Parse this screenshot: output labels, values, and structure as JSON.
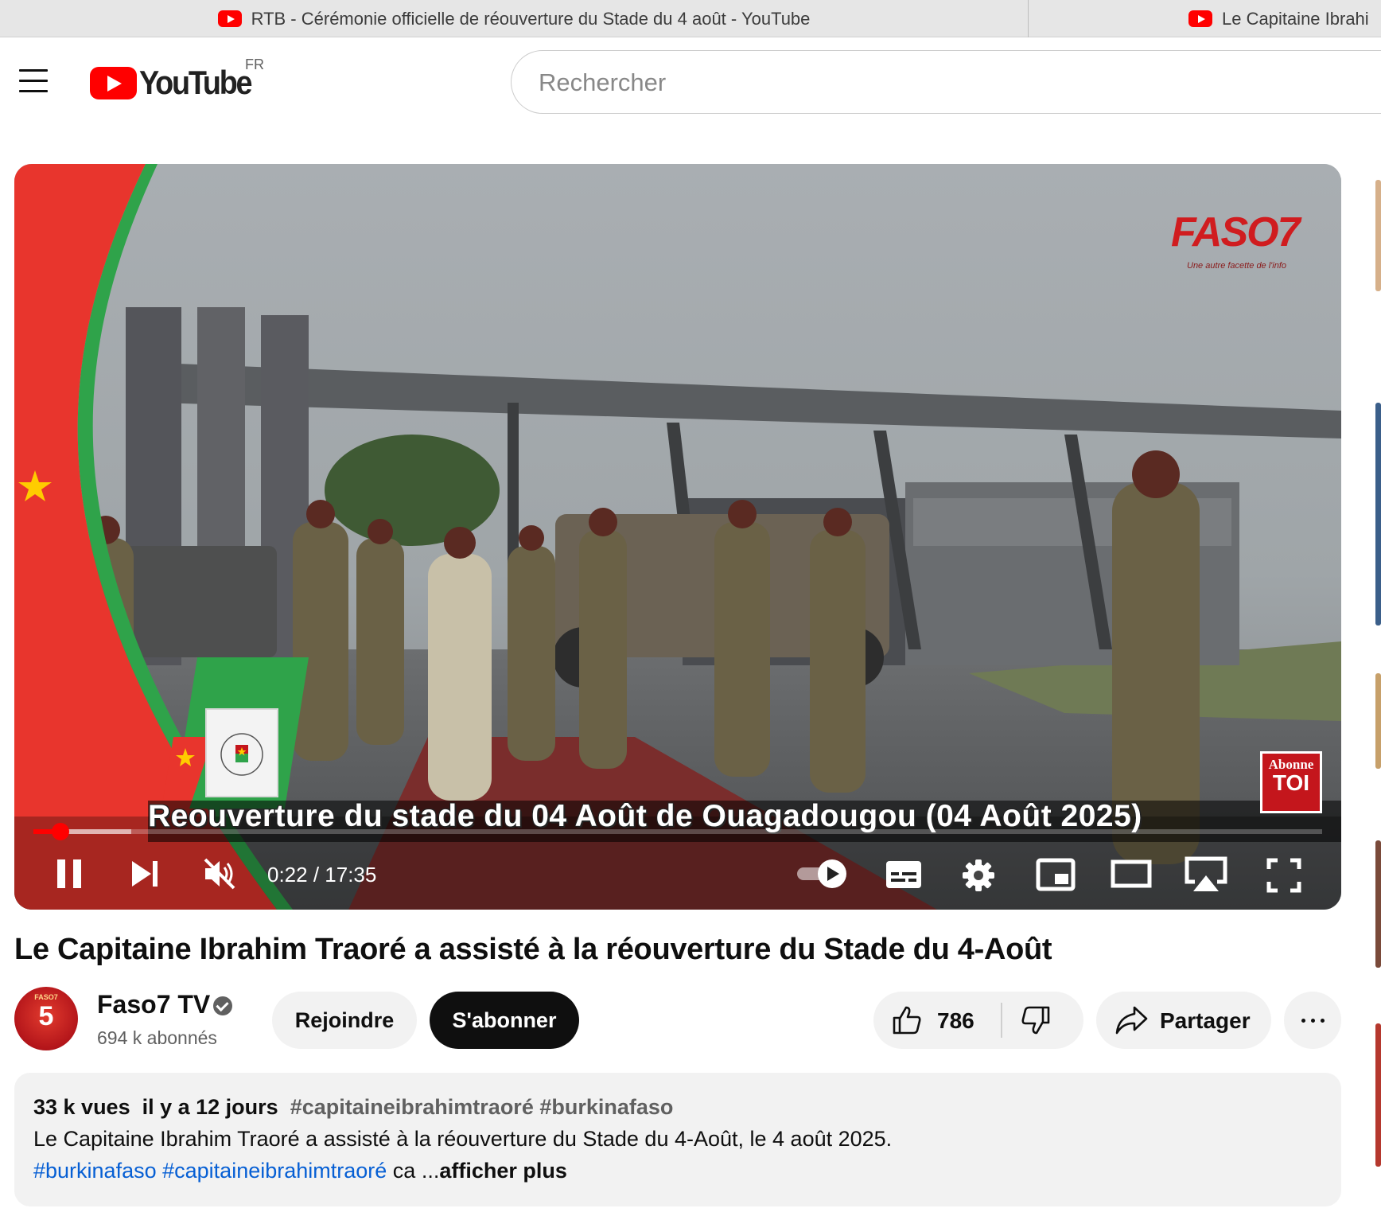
{
  "browser": {
    "tabs": [
      {
        "title": "RTB - Cérémonie officielle de réouverture du Stade du 4 août - YouTube",
        "active": true
      },
      {
        "title": "Le Capitaine Ibrahi",
        "active": false
      }
    ]
  },
  "masthead": {
    "logo_text": "YouTube",
    "region": "FR",
    "search_placeholder": "Rechercher"
  },
  "player": {
    "watermark": "FASO7",
    "watermark_tagline": "Une autre facette de l'info",
    "subscribe_badge_top": "Abonne",
    "subscribe_badge_bottom": "TOI",
    "lower_third": "Reouverture du stade du 04 Août de Ouagadougou (04 Août 2025)",
    "time_current": "0:22",
    "time_total": "17:35",
    "timecode": "0:22 / 17:35",
    "progress_played_pct": 2.1,
    "progress_loaded_pct": 7.6,
    "controls": [
      "pause-icon",
      "next-icon",
      "muted-icon",
      "autoplay-toggle",
      "subtitles-icon",
      "settings-icon",
      "miniplayer-icon",
      "theater-icon",
      "airplay-icon",
      "fullscreen-icon"
    ]
  },
  "video": {
    "title": "Le Capitaine Ibrahim Traoré a assisté à la réouverture du Stade du 4-Août"
  },
  "channel": {
    "name": "Faso7 TV",
    "subscribers": "694 k abonnés",
    "avatar_label": "5",
    "avatar_brand": "FASO7",
    "verified": true
  },
  "actions": {
    "join_label": "Rejoindre",
    "subscribe_label": "S'abonner",
    "likes": "786",
    "share_label": "Partager"
  },
  "description": {
    "views": "33 k vues",
    "date": "il y a 12 jours",
    "hashtags_top": "#capitaineibrahimtraoré #burkinafaso",
    "text": "Le Capitaine Ibrahim Traoré a assisté à la réouverture du Stade du 4-Août, le 4 août 2025.",
    "tag1": "#burkinafaso",
    "tag2": "#capitaineibrahimtraoré",
    "trail": "ca ...",
    "more_label": "afficher plus"
  },
  "colors": {
    "brand_red": "#ff0000",
    "link_blue": "#065fd4",
    "text_primary": "#0f0f0f",
    "text_secondary": "#606060"
  }
}
